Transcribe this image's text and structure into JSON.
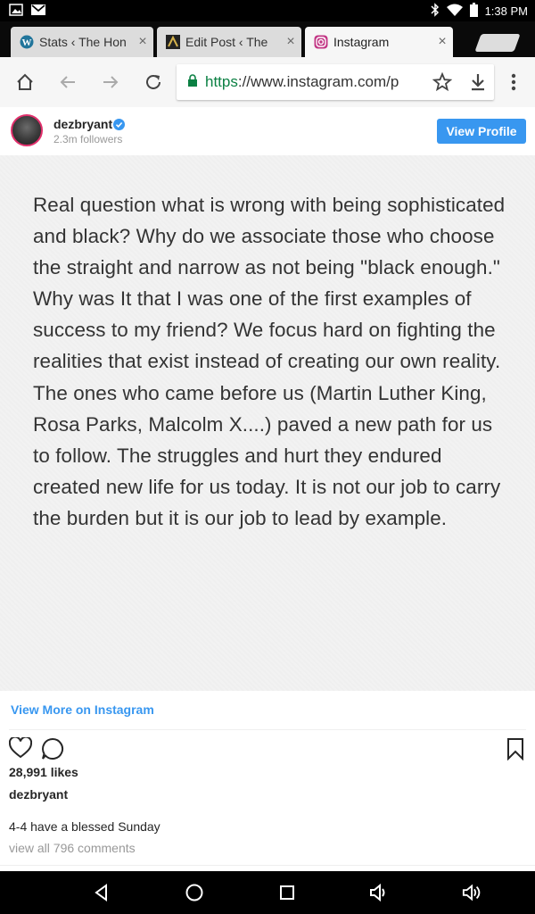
{
  "status_bar": {
    "time": "1:38 PM",
    "icons": [
      "image-icon",
      "gmail-icon",
      "bluetooth-icon",
      "wifi-icon",
      "battery-icon"
    ]
  },
  "tabs": [
    {
      "title": "Stats ‹ The Hon",
      "favicon": "wordpress-icon",
      "close": "×"
    },
    {
      "title": "Edit Post ‹ The",
      "favicon": "site-icon",
      "close": "×"
    },
    {
      "title": "Instagram",
      "favicon": "instagram-icon",
      "close": "×"
    }
  ],
  "toolbar": {
    "url_scheme": "https",
    "url_rest": "://www.instagram.com/p",
    "icons": [
      "home-icon",
      "back-icon",
      "forward-icon",
      "reload-icon",
      "lock-icon",
      "star-icon",
      "download-icon",
      "menu-icon"
    ]
  },
  "post": {
    "username": "dezbryant",
    "followers": "2.3m followers",
    "view_profile": "View Profile",
    "image_text": "Real question what is wrong with being sophisticated and black? Why do we associate those who choose the straight and narrow as not being \"black enough.\" Why was It that I was one of the first examples of success to my friend? We focus hard on fighting the realities that exist instead of creating our own reality. The ones who came before us (Martin Luther King, Rosa Parks, Malcolm X....) paved a new path for us to follow. The struggles and hurt they endured created new life for us today. It is not our job to carry the burden but it is our job to lead by example.",
    "view_more": "View More on Instagram",
    "likes": "28,991 likes",
    "caption_user": "dezbryant",
    "caption": "4-4 have a blessed Sunday",
    "comments": "view all 796 comments"
  },
  "colors": {
    "accent": "#3897f0",
    "secure_green": "#0b8043"
  },
  "nav_bar": {
    "icons": [
      "back-triangle-icon",
      "home-circle-icon",
      "recents-square-icon",
      "volume-down-icon",
      "volume-up-icon"
    ]
  }
}
